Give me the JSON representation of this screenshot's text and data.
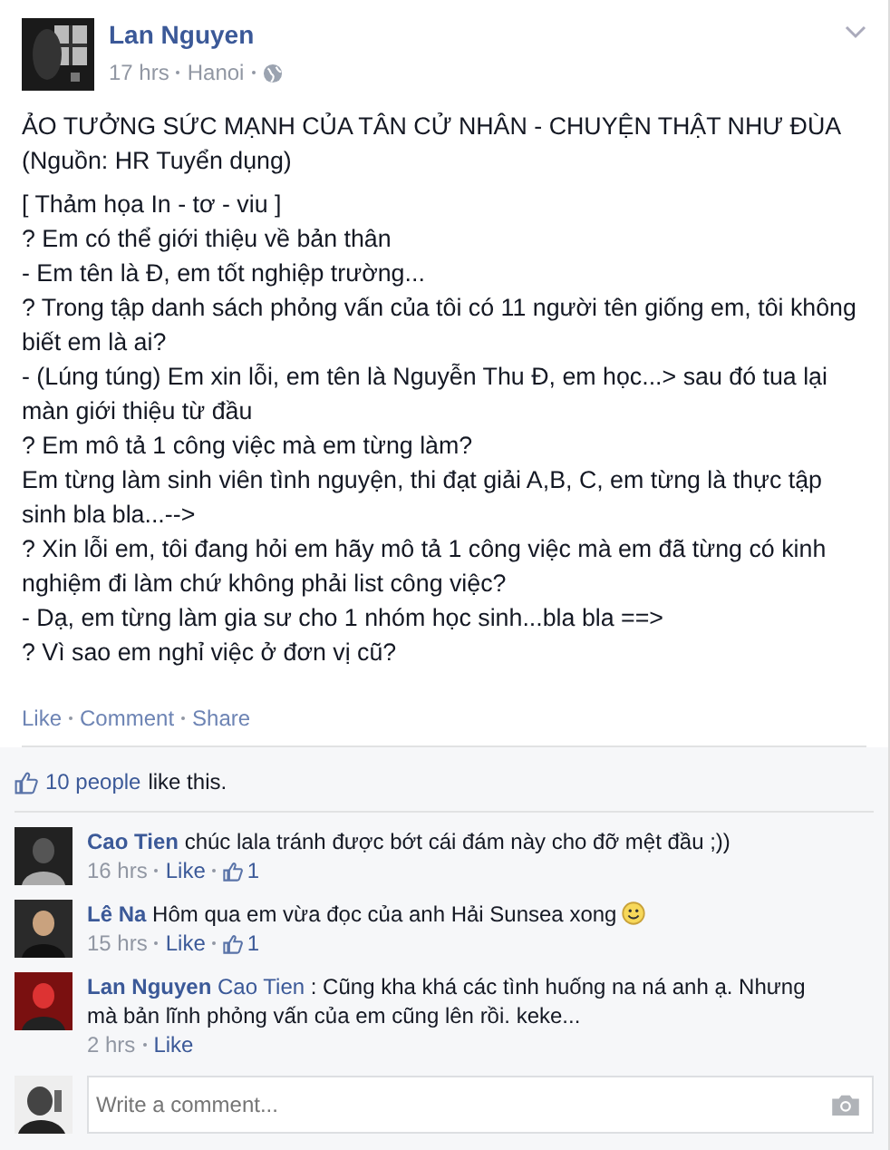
{
  "post": {
    "author": "Lan Nguyen",
    "time": "17 hrs",
    "location": "Hanoi",
    "title_lines": [
      "ẢO TƯỞNG SỨC MẠNH CỦA TÂN CỬ NHÂN - CHUYỆN THẬT NHƯ ĐÙA",
      "(Nguồn: HR Tuyển dụng)"
    ],
    "body_lines": [
      "[ Thảm họa In - tơ - viu ]",
      "? Em có thể giới thiệu về bản thân",
      "- Em tên là Đ, em tốt nghiệp trường...",
      "? Trong tập danh sách phỏng vấn của tôi có 11 người tên giống em, tôi không biết em là ai?",
      "- (Lúng túng) Em xin lỗi, em tên là Nguyễn Thu Đ, em học...> sau đó tua lại màn giới thiệu từ đầu",
      "? Em mô tả 1 công việc mà em từng làm?",
      "Em từng làm sinh viên tình nguyện, thi đạt giải A,B, C, em từng là thực tập sinh bla bla...-->",
      "? Xin lỗi em, tôi đang hỏi em hãy mô tả 1 công việc mà em đã từng có kinh nghiệm đi làm chứ không phải list công việc?",
      "- Dạ, em từng làm gia sư cho 1 nhóm học sinh...bla bla ==>",
      "? Vì sao em nghỉ việc ở đơn vị cũ?"
    ],
    "actions": [
      "Like",
      "Comment",
      "Share"
    ]
  },
  "likes": {
    "people": "10 people",
    "text": "like this."
  },
  "comments": [
    {
      "author": "Cao Tien",
      "text": "chúc lala tránh được bớt cái đám này cho đỡ mệt đầu ;))",
      "emoticon": false,
      "time": "16 hrs",
      "action": "Like",
      "likes": "1"
    },
    {
      "author": "Lê Na",
      "text": "Hôm qua em vừa đọc của anh Hải Sunsea xong",
      "emoticon": true,
      "time": "15 hrs",
      "action": "Like",
      "likes": "1"
    },
    {
      "author": "Lan Nguyen",
      "reply_to": "Cao Tien",
      "text": ": Cũng kha khá các tình huống na ná anh ạ. Nhưng mà bản lĩnh phỏng vấn của em cũng lên rồi. keke...",
      "emoticon": false,
      "time": "2 hrs",
      "action": "Like"
    }
  ],
  "composer": {
    "placeholder": "Write a comment..."
  }
}
